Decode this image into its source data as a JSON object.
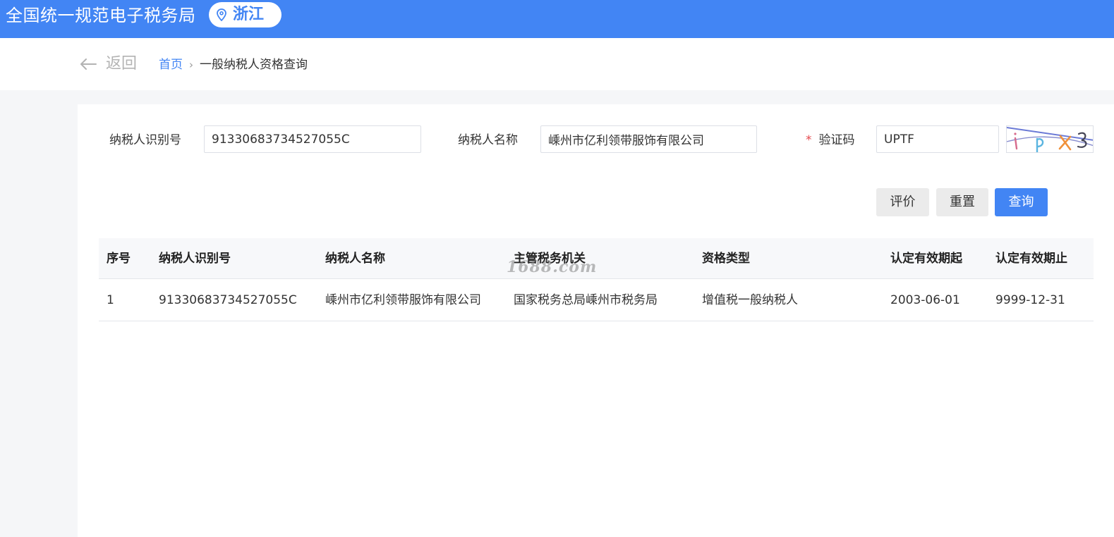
{
  "header": {
    "site_title": "全国统一规范电子税务局",
    "region": "浙江",
    "location_icon": "location-pin-icon",
    "bg_color": "#4285f4"
  },
  "nav": {
    "back_label": "返回",
    "back_icon": "arrow-left-icon",
    "breadcrumb": {
      "home": "首页",
      "separator": "›",
      "current": "一般纳税人资格查询"
    }
  },
  "form": {
    "taxpayer_id_label": "纳税人识别号",
    "taxpayer_id_value": "91330683734527055C",
    "taxpayer_name_label": "纳税人名称",
    "taxpayer_name_value": "嵊州市亿利领带服饰有限公司",
    "captcha_required_mark": "*",
    "captcha_label": "验证码",
    "captcha_value": "UPTF"
  },
  "actions": {
    "evaluate": "评价",
    "reset": "重置",
    "query": "查询"
  },
  "table": {
    "columns": [
      "序号",
      "纳税人识别号",
      "纳税人名称",
      "主管税务机关",
      "资格类型",
      "认定有效期起",
      "认定有效期止"
    ],
    "rows": [
      [
        "1",
        "91330683734527055C",
        "嵊州市亿利领带服饰有限公司",
        "国家税务总局嵊州市税务局",
        "增值税一般纳税人",
        "2003-06-01",
        "9999-12-31"
      ]
    ]
  },
  "watermark": "1688.com",
  "colors": {
    "primary": "#4285f4",
    "required": "#e5484d",
    "button_gray": "#ebebeb"
  }
}
